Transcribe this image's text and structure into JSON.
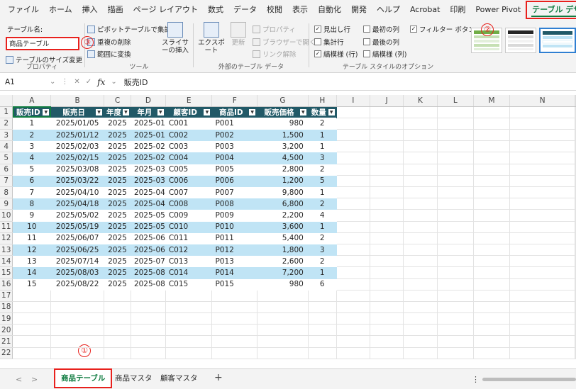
{
  "ribbon": {
    "tabs": [
      "ファイル",
      "ホーム",
      "挿入",
      "描画",
      "ページ レイアウト",
      "数式",
      "データ",
      "校閲",
      "表示",
      "自動化",
      "開発",
      "ヘルプ",
      "Acrobat",
      "印刷",
      "Power Pivot",
      "テーブル デザイン"
    ],
    "active_tab": "テーブル デザイン",
    "properties": {
      "table_name_label": "テーブル名:",
      "table_name_value": "商品テーブル",
      "resize_label": "テーブルのサイズ変更",
      "group_label": "プロパティ"
    },
    "tools": {
      "pivot": "ピボットテーブルで集計",
      "remove_dup": "重複の削除",
      "convert_range": "範囲に変換",
      "slicer": "スライサーの挿入",
      "group_label": "ツール"
    },
    "external": {
      "export": "エクスポート",
      "refresh": "更新",
      "properties": "プロパティ",
      "open_browser": "ブラウザーで開く",
      "unlink": "リンク解除",
      "group_label": "外部のテーブル データ"
    },
    "style_options": {
      "header_row": "見出し行",
      "total_row": "集計行",
      "banded_rows": "縞模様 (行)",
      "first_col": "最初の列",
      "last_col": "最後の列",
      "banded_cols": "縞模様 (列)",
      "filter_button": "フィルター ボタン",
      "group_label": "テーブル スタイルのオプション"
    }
  },
  "callouts": [
    "①",
    "②",
    "③"
  ],
  "formula_bar": {
    "name_box": "A1",
    "fx": "fx",
    "content": "販売ID"
  },
  "columns": [
    "A",
    "B",
    "C",
    "D",
    "E",
    "F",
    "G",
    "H",
    "I",
    "J",
    "K",
    "L",
    "M",
    "N"
  ],
  "table": {
    "headers": [
      "販売ID",
      "販売日",
      "年度",
      "年月",
      "顧客ID",
      "商品ID",
      "販売価格",
      "数量"
    ],
    "rows": [
      [
        "1",
        "2025/01/05",
        "2025",
        "2025-01",
        "C001",
        "P001",
        "980",
        "2"
      ],
      [
        "2",
        "2025/01/12",
        "2025",
        "2025-01",
        "C002",
        "P002",
        "1,500",
        "1"
      ],
      [
        "3",
        "2025/02/03",
        "2025",
        "2025-02",
        "C003",
        "P003",
        "3,200",
        "1"
      ],
      [
        "4",
        "2025/02/15",
        "2025",
        "2025-02",
        "C004",
        "P004",
        "4,500",
        "3"
      ],
      [
        "5",
        "2025/03/08",
        "2025",
        "2025-03",
        "C005",
        "P005",
        "2,800",
        "2"
      ],
      [
        "6",
        "2025/03/22",
        "2025",
        "2025-03",
        "C006",
        "P006",
        "1,200",
        "5"
      ],
      [
        "7",
        "2025/04/10",
        "2025",
        "2025-04",
        "C007",
        "P007",
        "9,800",
        "1"
      ],
      [
        "8",
        "2025/04/18",
        "2025",
        "2025-04",
        "C008",
        "P008",
        "6,800",
        "2"
      ],
      [
        "9",
        "2025/05/02",
        "2025",
        "2025-05",
        "C009",
        "P009",
        "2,200",
        "4"
      ],
      [
        "10",
        "2025/05/19",
        "2025",
        "2025-05",
        "C010",
        "P010",
        "3,600",
        "1"
      ],
      [
        "11",
        "2025/06/07",
        "2025",
        "2025-06",
        "C011",
        "P011",
        "5,400",
        "2"
      ],
      [
        "12",
        "2025/06/25",
        "2025",
        "2025-06",
        "C012",
        "P012",
        "1,800",
        "3"
      ],
      [
        "13",
        "2025/07/14",
        "2025",
        "2025-07",
        "C013",
        "P013",
        "2,600",
        "2"
      ],
      [
        "14",
        "2025/08/03",
        "2025",
        "2025-08",
        "C014",
        "P014",
        "7,200",
        "1"
      ],
      [
        "15",
        "2025/08/22",
        "2025",
        "2025-08",
        "C015",
        "P015",
        "980",
        "6"
      ]
    ]
  },
  "row_numbers": [
    "1",
    "2",
    "3",
    "4",
    "5",
    "6",
    "7",
    "8",
    "9",
    "10",
    "11",
    "12",
    "13",
    "14",
    "15",
    "16",
    "17",
    "18",
    "19",
    "20",
    "21",
    "22"
  ],
  "sheets": [
    "商品テーブル",
    "商品マスタ",
    "顧客マスタ"
  ],
  "active_sheet": "商品テーブル",
  "sheet_nav": {
    "prev": "<",
    "next": ">",
    "add": "+",
    "more": "⋮"
  },
  "colors": {
    "header": "#215967",
    "band": "#c0e4f5",
    "accent": "#107c41",
    "highlight": "#e8211d"
  }
}
